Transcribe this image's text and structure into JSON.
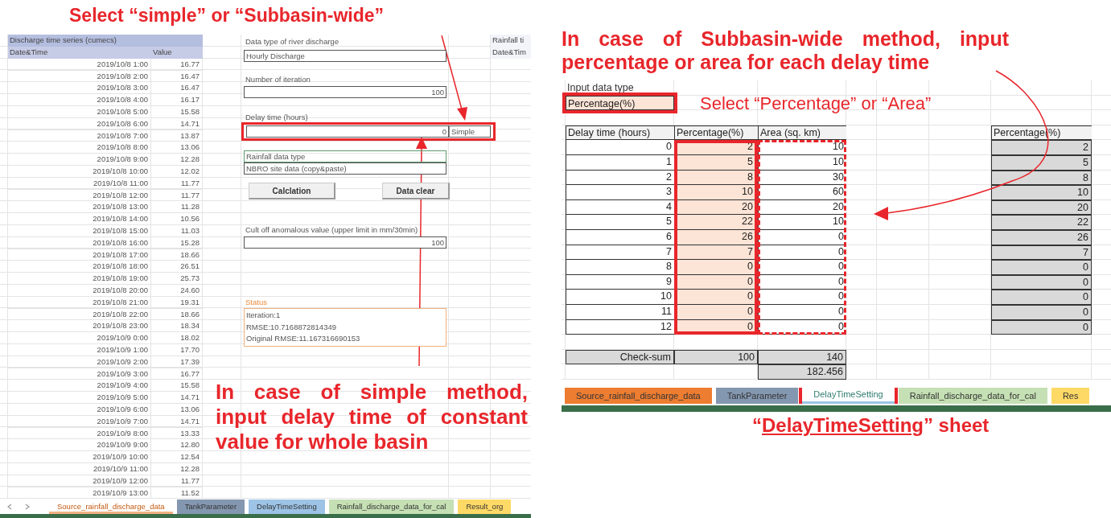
{
  "left_figure": {
    "callout": "Select “simple” or “Subbasin-wide”",
    "sheet": {
      "series_title": "Discharge time series (cumecs)",
      "columns": [
        "Date&Time",
        "Value"
      ],
      "rows": [
        [
          "2019/10/8 1:00",
          "16.77"
        ],
        [
          "2019/10/8 2:00",
          "16.47"
        ],
        [
          "2019/10/8 3:00",
          "16.47"
        ],
        [
          "2019/10/8 4:00",
          "16.17"
        ],
        [
          "2019/10/8 5:00",
          "15.58"
        ],
        [
          "2019/10/8 6:00",
          "14.71"
        ],
        [
          "2019/10/8 7:00",
          "13.87"
        ],
        [
          "2019/10/8 8:00",
          "13.06"
        ],
        [
          "2019/10/8 9:00",
          "12.28"
        ],
        [
          "2019/10/8 10:00",
          "12.02"
        ],
        [
          "2019/10/8 11:00",
          "11.77"
        ],
        [
          "2019/10/8 12:00",
          "11.77"
        ],
        [
          "2019/10/8 13:00",
          "11.28"
        ],
        [
          "2019/10/8 14:00",
          "10.56"
        ],
        [
          "2019/10/8 15:00",
          "11.03"
        ],
        [
          "2019/10/8 16:00",
          "15.28"
        ],
        [
          "2019/10/8 17:00",
          "18.66"
        ],
        [
          "2019/10/8 18:00",
          "26.51"
        ],
        [
          "2019/10/8 19:00",
          "25.73"
        ],
        [
          "2019/10/8 20:00",
          "24.60"
        ],
        [
          "2019/10/8 21:00",
          "19.31"
        ],
        [
          "2019/10/8 22:00",
          "18.66"
        ],
        [
          "2019/10/8 23:00",
          "18.34"
        ],
        [
          "2019/10/9 0:00",
          "18.02"
        ],
        [
          "2019/10/9 1:00",
          "17.70"
        ],
        [
          "2019/10/9 2:00",
          "17.39"
        ],
        [
          "2019/10/9 3:00",
          "16.77"
        ],
        [
          "2019/10/9 4:00",
          "15.58"
        ],
        [
          "2019/10/9 5:00",
          "14.71"
        ],
        [
          "2019/10/9 6:00",
          "13.06"
        ],
        [
          "2019/10/9 7:00",
          "14.71"
        ],
        [
          "2019/10/9 8:00",
          "13.33"
        ],
        [
          "2019/10/9 9:00",
          "12.80"
        ],
        [
          "2019/10/9 10:00",
          "12.54"
        ],
        [
          "2019/10/9 11:00",
          "12.28"
        ],
        [
          "2019/10/9 12:00",
          "11.77"
        ],
        [
          "2019/10/9 13:00",
          "11.52"
        ]
      ],
      "discharge_type": {
        "label": "Data type of river discharge",
        "value": "Hourly Discharge"
      },
      "iterations": {
        "label": "Number of iteration",
        "value": "100"
      },
      "delay_time": {
        "label": "Delay time (hours)",
        "value": "0",
        "method": "Simple",
        "highlighted": true
      },
      "rainfall_type": {
        "label": "Rainfall data type",
        "value": "NBRO site data (copy&paste)"
      },
      "buttons": [
        "Calclation",
        "Data clear"
      ],
      "cutoff": {
        "label": "Cult off anomalous value (upper limit in mm/30min)",
        "value": "100"
      },
      "status": {
        "label": "Status",
        "lines": [
          "Iteration:1",
          "RMSE:10.7168872814349",
          "Original RMSE:11.167316690153"
        ]
      },
      "side_columns": [
        "Rainfall ti",
        "Date&Tim"
      ],
      "tabs": [
        {
          "label": "Source_rainfall_discharge_data",
          "color": "#f4b183",
          "selected": true
        },
        {
          "label": "TankParameter",
          "color": "#8497b0",
          "selected": false
        },
        {
          "label": "DelayTimeSetting",
          "color": "#9dc3e6",
          "selected": false
        },
        {
          "label": "Rainfall_discharge_data_for_cal",
          "color": "#c5e0b4",
          "selected": false
        },
        {
          "label": "Result_org",
          "color": "#ffd966",
          "selected": false
        }
      ]
    },
    "note": "In case of simple method, input delay time of constant value for whole basin"
  },
  "right_figure": {
    "callout": "In case of Subbasin-wide method, input percentage or area for each delay time",
    "sheet": {
      "input_type": {
        "label": "Input data type",
        "value": "Percentage(%)",
        "highlighted": true
      },
      "hint": "Select “Percentage” or “Area”",
      "table": {
        "columns": [
          "Delay time (hours)",
          "Percentage(%)",
          "Area (sq. km)"
        ],
        "rows": [
          [
            "0",
            "2",
            "10"
          ],
          [
            "1",
            "5",
            "10"
          ],
          [
            "2",
            "8",
            "30"
          ],
          [
            "3",
            "10",
            "60"
          ],
          [
            "4",
            "20",
            "20"
          ],
          [
            "5",
            "22",
            "10"
          ],
          [
            "6",
            "26",
            "0"
          ],
          [
            "7",
            "7",
            "0"
          ],
          [
            "8",
            "0",
            "0"
          ],
          [
            "9",
            "0",
            "0"
          ],
          [
            "10",
            "0",
            "0"
          ],
          [
            "11",
            "0",
            "0"
          ],
          [
            "12",
            "0",
            "0"
          ]
        ],
        "percentage_highlighted": true,
        "area_highlighted": true,
        "checksum": {
          "label": "Check-sum",
          "percentage": "100",
          "area": "140",
          "area_total": "182.456"
        }
      },
      "result_table": {
        "column": "Percentage(%)",
        "rows": [
          "2",
          "5",
          "8",
          "10",
          "20",
          "22",
          "26",
          "7",
          "0",
          "0",
          "0",
          "0",
          "0"
        ]
      },
      "tabs": [
        {
          "label": "Source_rainfall_discharge_data",
          "color": "#ed7d31",
          "selected": false,
          "highlighted": false
        },
        {
          "label": "TankParameter",
          "color": "#8497b0",
          "selected": false,
          "highlighted": false
        },
        {
          "label": "DelayTimeSetting",
          "color": "#9dc3e6",
          "selected": true,
          "highlighted": true
        },
        {
          "label": "Rainfall_discharge_data_for_cal",
          "color": "#c5e0b4",
          "selected": false,
          "highlighted": false
        },
        {
          "label": "Res",
          "color": "#ffd966",
          "selected": false,
          "highlighted": false
        }
      ]
    },
    "caption": {
      "before": "“",
      "sheet_name": "DelayTimeSetting",
      "after": "” sheet"
    }
  }
}
